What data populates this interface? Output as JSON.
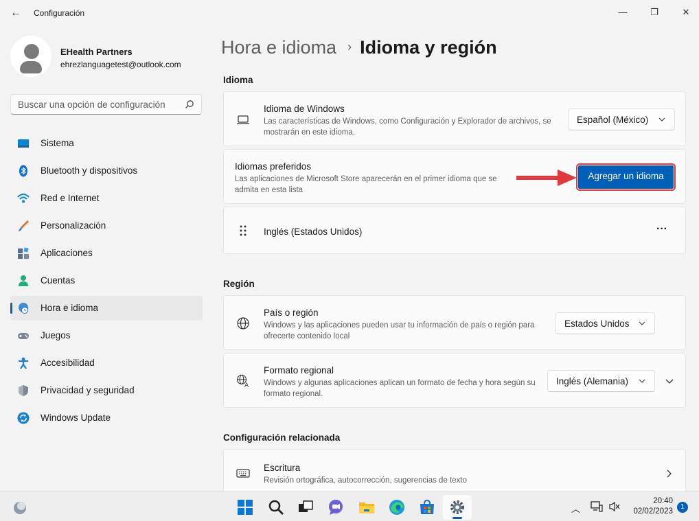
{
  "window": {
    "title": "Configuración",
    "controls": {
      "minimize": "—",
      "maximize": "❐",
      "close": "✕"
    }
  },
  "profile": {
    "name": "EHealth Partners",
    "email": "ehrezlanguagetest@outlook.com"
  },
  "search": {
    "placeholder": "Buscar una opción de configuración"
  },
  "sidebar": {
    "items": [
      {
        "label": "Sistema",
        "icon": "system-icon"
      },
      {
        "label": "Bluetooth y dispositivos",
        "icon": "bluetooth-icon"
      },
      {
        "label": "Red e Internet",
        "icon": "wifi-icon"
      },
      {
        "label": "Personalización",
        "icon": "brush-icon"
      },
      {
        "label": "Aplicaciones",
        "icon": "apps-icon"
      },
      {
        "label": "Cuentas",
        "icon": "account-icon"
      },
      {
        "label": "Hora e idioma",
        "icon": "time-language-icon",
        "selected": true
      },
      {
        "label": "Juegos",
        "icon": "gamepad-icon"
      },
      {
        "label": "Accesibilidad",
        "icon": "accessibility-icon"
      },
      {
        "label": "Privacidad y seguridad",
        "icon": "shield-icon"
      },
      {
        "label": "Windows Update",
        "icon": "update-icon"
      }
    ]
  },
  "breadcrumb": {
    "parent": "Hora e idioma",
    "separator": "›",
    "current": "Idioma y región"
  },
  "sections": {
    "idioma": {
      "title": "Idioma",
      "windows_language": {
        "title": "Idioma de Windows",
        "description": "Las características de Windows, como Configuración y Explorador de archivos, se mostrarán en este idioma.",
        "value": "Español (México)"
      },
      "preferred": {
        "title": "Idiomas preferidos",
        "description": "Las aplicaciones de Microsoft Store aparecerán en el primer idioma que se admita en esta lista",
        "button": "Agregar un idioma"
      },
      "languages": [
        {
          "name": "Inglés (Estados Unidos)",
          "more": "···"
        }
      ]
    },
    "region": {
      "title": "Región",
      "country": {
        "title": "País o región",
        "description": "Windows y las aplicaciones pueden usar tu información de país o región para ofrecerte contenido local",
        "value": "Estados Unidos"
      },
      "format": {
        "title": "Formato regional",
        "description": "Windows y algunas aplicaciones aplican un formato de fecha y hora según su formato regional.",
        "value": "Inglés (Alemania)"
      }
    },
    "related": {
      "title": "Configuración relacionada",
      "typing": {
        "title": "Escritura",
        "description": "Revisión ortográfica, autocorrección, sugerencias de texto"
      }
    }
  },
  "taskbar": {
    "time": "20:40",
    "date": "02/02/2023",
    "notifications": "1"
  },
  "colors": {
    "accent": "#005fb8",
    "highlight": "#e0393e"
  }
}
